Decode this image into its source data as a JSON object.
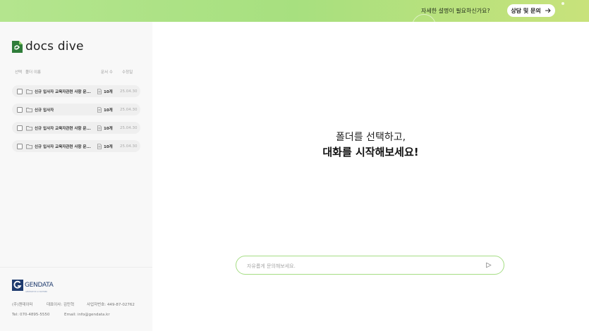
{
  "banner": {
    "text": "자세한 설명이 필요하신가요?",
    "button_label": "상담 및 문의",
    "icon": "arrow-right-icon"
  },
  "sidebar": {
    "logo_text": "docs dive",
    "headers": {
      "select": "선택",
      "folder_name": "폴더 이름",
      "doc_count": "문서 수",
      "modified": "수정일"
    },
    "folders": [
      {
        "name": "신규 입사자 교육자관련 사항 문...",
        "count": "10개",
        "date": "25.04.30"
      },
      {
        "name": "신규 입사자",
        "count": "10개",
        "date": "25.04.30"
      },
      {
        "name": "신규 입사자 교육자관련 사항 문...",
        "count": "10개",
        "date": "25.04.30"
      },
      {
        "name": "신규 입사자 교육자관련 사항 문...",
        "count": "10개",
        "date": "25.04.30"
      }
    ]
  },
  "footer": {
    "company_logo": "GENDATA",
    "company_logo_sub": "GENERATIVE AI PARTNER",
    "company": "(주)젠데이터",
    "ceo": "대표이사: 김민혁",
    "biz_no": "사업자번호: 449-87-02762",
    "tel": "Tel: 070-4895-5550",
    "email": "Email: info@gendata.kr"
  },
  "main": {
    "title_line1": "폴더를 선택하고,",
    "title_line2": "대화를 시작해보세요!",
    "chat_placeholder": "자유롭게 문의해보세요.",
    "send_icon": "send-icon"
  },
  "colors": {
    "accent_green": "#8fd26a",
    "banner_gradient_start": "#b4e58e",
    "banner_gradient_end": "#c8e27b",
    "brand_navy": "#1f3b6e"
  }
}
